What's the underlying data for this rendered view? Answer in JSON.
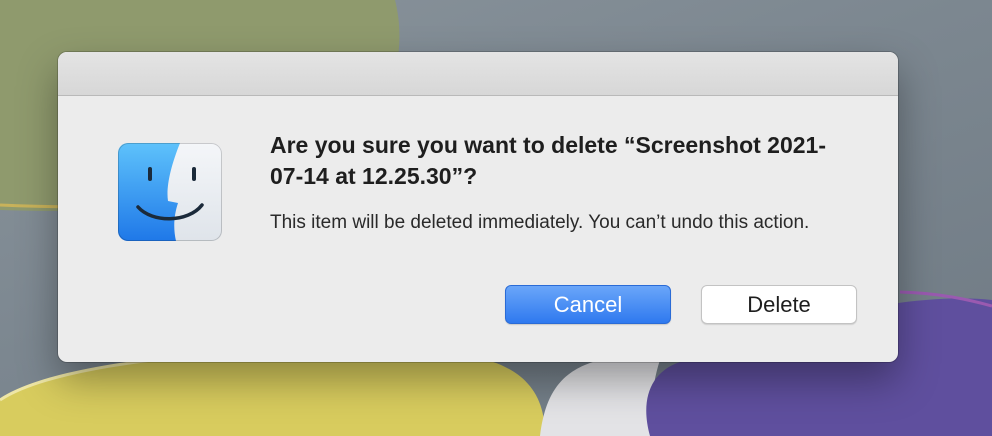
{
  "dialog": {
    "title": "Are you sure you want to delete “Screenshot 2021-07-14 at 12.25.30”?",
    "message": "This item will be deleted immediately. You can’t undo this action.",
    "cancel_label": "Cancel",
    "delete_label": "Delete",
    "icon": "finder-icon"
  },
  "colors": {
    "default_button": "#2f79ef",
    "dialog_background": "#ececec"
  }
}
